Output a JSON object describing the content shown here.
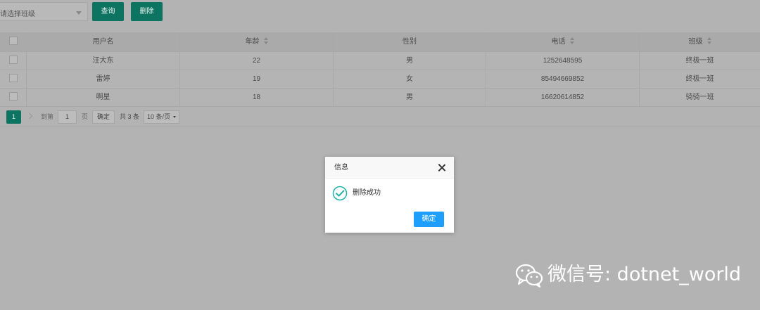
{
  "toolbar": {
    "class_select_placeholder": "请选择班级",
    "query_label": "查询",
    "delete_label": "删除"
  },
  "table": {
    "columns": [
      "用户名",
      "年龄",
      "性别",
      "电话",
      "班级"
    ],
    "rows": [
      [
        "汪大东",
        "22",
        "男",
        "1252648595",
        "终极一班"
      ],
      [
        "雷婷",
        "19",
        "女",
        "85494669852",
        "终极一班"
      ],
      [
        "啊星",
        "18",
        "男",
        "16620614852",
        "骑骑一班"
      ]
    ]
  },
  "pagination": {
    "current_page": "1",
    "goto_label": "到第",
    "page_input": "1",
    "page_unit": "页",
    "confirm_label": "确定",
    "total_label": "共 3 条",
    "page_size": "10 条/页"
  },
  "dialog": {
    "title": "信息",
    "message": "删除成功",
    "ok_label": "确定",
    "icon": "check-circle-icon",
    "accent": "#1e9fff",
    "icon_color": "#20b2aa"
  },
  "watermark": {
    "text": "微信号: dotnet_world"
  },
  "colors": {
    "primary_green": "#0d7462",
    "overlay": "#b3b3b3"
  }
}
